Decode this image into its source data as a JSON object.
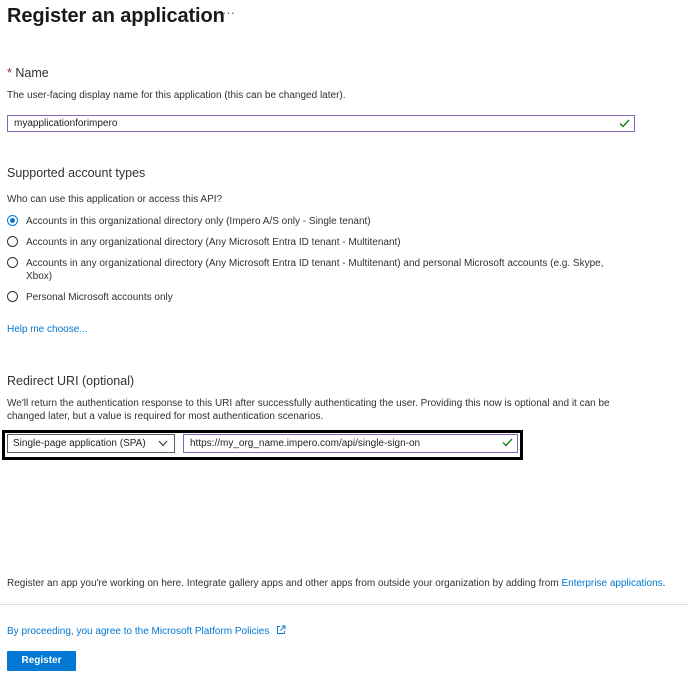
{
  "page": {
    "title": "Register an application",
    "more_label": "···"
  },
  "name_section": {
    "required_mark": "*",
    "heading": "Name",
    "description": "The user-facing display name for this application (this can be changed later).",
    "value": "myapplicationforimpero"
  },
  "account_types": {
    "heading": "Supported account types",
    "question": "Who can use this application or access this API?",
    "options": [
      {
        "label": "Accounts in this organizational directory only (Impero A/S only - Single tenant)",
        "selected": true
      },
      {
        "label": "Accounts in any organizational directory (Any Microsoft Entra ID tenant - Multitenant)",
        "selected": false
      },
      {
        "label": "Accounts in any organizational directory (Any Microsoft Entra ID tenant - Multitenant) and personal Microsoft accounts (e.g. Skype, Xbox)",
        "selected": false
      },
      {
        "label": "Personal Microsoft accounts only",
        "selected": false
      }
    ],
    "help_link": "Help me choose..."
  },
  "redirect": {
    "heading": "Redirect URI (optional)",
    "description": "We'll return the authentication response to this URI after successfully authenticating the user. Providing this now is optional and it can be changed later, but a value is required for most authentication scenarios.",
    "platform": "Single-page application (SPA)",
    "uri": "https://my_org_name.impero.com/api/single-sign-on"
  },
  "footer": {
    "register_note": "Register an app you're working on here. Integrate gallery apps and other apps from outside your organization by adding from",
    "enterprise_link": "Enterprise applications",
    "period": ".",
    "policy_link": "By proceeding, you agree to the Microsoft Platform Policies",
    "register_button": "Register"
  },
  "colors": {
    "accent": "#0078d4",
    "valid_border": "#8764b8",
    "valid_check": "#107c10",
    "required": "#a4262c"
  }
}
